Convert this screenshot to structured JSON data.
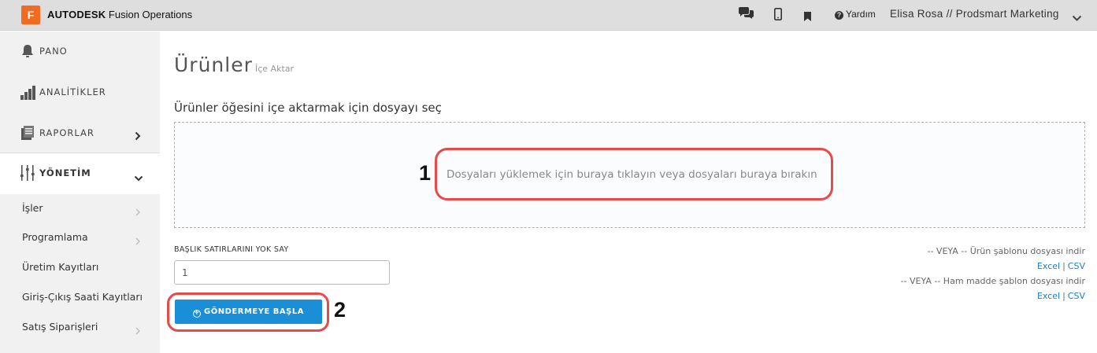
{
  "topbar": {
    "logo_letter": "F",
    "brand_bold": "AUTODESK",
    "brand_rest": " Fusion Operations",
    "chat_icon": "chat-bubbles-icon",
    "mobile_icon": "mobile-phone-icon",
    "bookmark_icon": "bookmark-icon",
    "help_label": "Yardım",
    "user_label": "Elisa Rosa // Prodsmart Marketing"
  },
  "sidebar": {
    "main_items": [
      {
        "label": "PANO",
        "icon": "bell-icon"
      },
      {
        "label": "ANALİTİKLER",
        "icon": "bar-chart-icon"
      },
      {
        "label": "RAPORLAR",
        "icon": "report-icon"
      },
      {
        "label": "YÖNETİM",
        "icon": "sliders-icon"
      }
    ],
    "sub_items": [
      {
        "label": "İşler"
      },
      {
        "label": "Programlama"
      },
      {
        "label": "Üretim Kayıtları"
      },
      {
        "label": "Giriş-Çıkış Saati Kayıtları"
      },
      {
        "label": "Satış Siparişleri"
      }
    ]
  },
  "main": {
    "title": "Ürünler",
    "subtitle": "İçe Aktar",
    "choose_text": "Ürünler öğesini içe aktarmak için dosyayı seç",
    "dropzone_text": "Dosyaları yüklemek için buraya tıklayın veya dosyaları buraya bırakın",
    "ignore_label": "BAŞLIK SATIRLARINI YOK SAY",
    "ignore_value": "1",
    "submit_label": "GÖNDERMEYE BAŞLA",
    "product_template_text": "-- VEYA -- Ürün şablonu dosyası indir",
    "raw_template_text": "-- VEYA -- Ham madde şablon dosyası indir",
    "excel_label": "Excel",
    "csv_label": "CSV",
    "link_separator": "|"
  },
  "annotations": {
    "marker_1": "1",
    "marker_2": "2",
    "highlight_color": "#e84a4a"
  },
  "colors": {
    "accent": "#1a8ed6",
    "logo": "#f26b23",
    "topbar": "#dedede",
    "sidebar": "#f1f1f1"
  }
}
